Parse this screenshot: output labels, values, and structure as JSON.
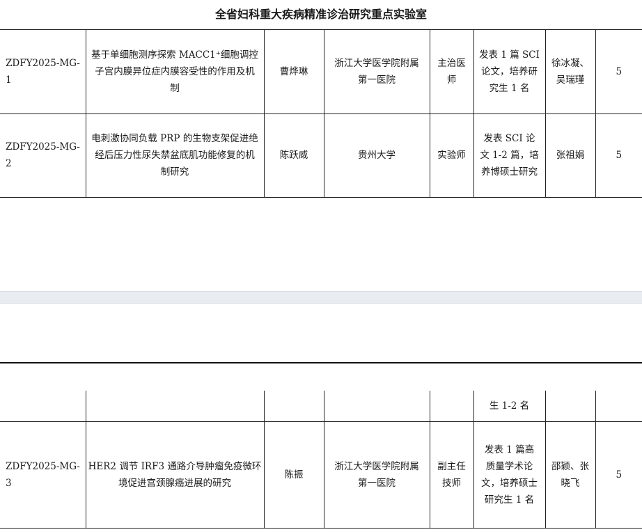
{
  "title": "全省妇科重大疾病精准诊治研究重点实验室",
  "rows_page1": [
    {
      "id": "ZDFY2025-MG-1",
      "topic": "基于单细胞测序探索 MACC1⁺细胞调控\n子宫内膜异位症内膜容受性的作用及机\n制",
      "leader": "曹烨琳",
      "institution": "浙江大学医学院附属\n第一医院",
      "title_rank": "主治医\n师",
      "outcome": "发表 1 篇 SCI\n论文，培养研\n究生 1 名",
      "members": "徐冰凝、\n吴瑞瑾",
      "value": "5"
    },
    {
      "id": "ZDFY2025-MG-2",
      "topic": "电刺激协同负载 PRP 的生物支架促进绝\n经后压力性尿失禁盆底肌功能修复的机\n制研究",
      "leader": "陈跃威",
      "institution": "贵州大学",
      "title_rank": "实验师",
      "outcome": "发表 SCI 论\n文 1-2 篇，培\n养博硕士研究",
      "members": "张祖娟",
      "value": "5"
    }
  ],
  "continuation": {
    "outcome": "生 1-2 名"
  },
  "rows_page2": [
    {
      "id": "ZDFY2025-MG-3",
      "topic": "HER2 调节 IRF3 通路介导肿瘤免疫微环\n境促进宫颈腺癌进展的研究",
      "leader": "陈振",
      "institution": "浙江大学医学院附属\n第一医院",
      "title_rank": "副主任\n技师",
      "outcome": "发表 1 篇高\n质量学术论\n文，培养硕士\n研究生 1 名",
      "members": "邵颖、张\n晓飞",
      "value": "5"
    }
  ]
}
